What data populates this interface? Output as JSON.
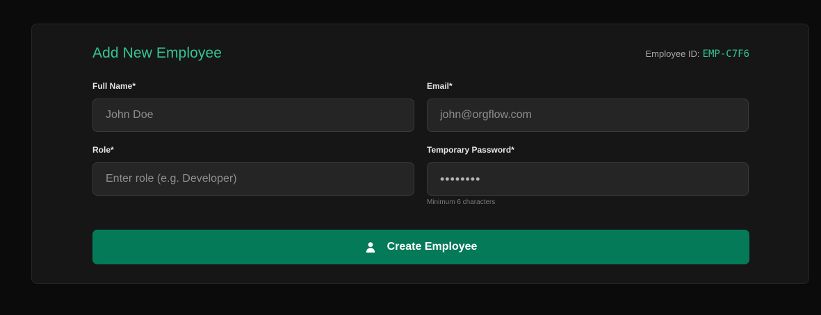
{
  "form": {
    "title": "Add New Employee",
    "employee_id_label": "Employee ID:",
    "employee_id_value": "EMP-C7F6",
    "fields": {
      "full_name": {
        "label": "Full Name*",
        "placeholder": "John Doe",
        "value": ""
      },
      "email": {
        "label": "Email*",
        "placeholder": "john@orgflow.com",
        "value": ""
      },
      "role": {
        "label": "Role*",
        "placeholder": "Enter role (e.g. Developer)",
        "value": ""
      },
      "password": {
        "label": "Temporary Password*",
        "value": "••••••••",
        "hint": "Minimum 6 characters"
      }
    },
    "submit_label": "Create Employee",
    "submit_icon": "user-icon"
  },
  "colors": {
    "accent": "#34c493",
    "button": "#057a58",
    "background": "#0b0b0b",
    "card": "#161616"
  }
}
